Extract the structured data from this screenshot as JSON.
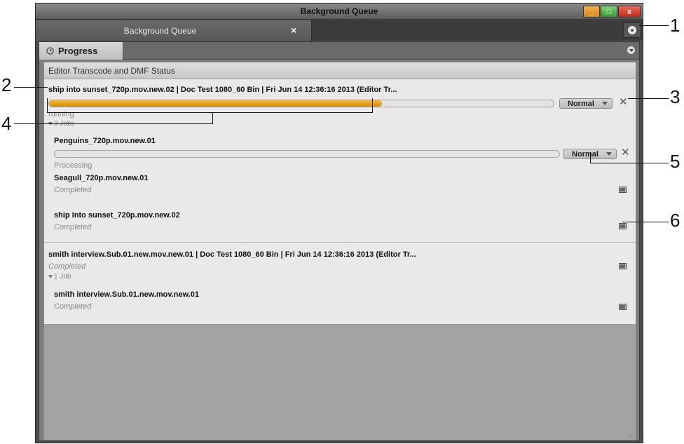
{
  "window": {
    "title": "Background Queue",
    "controls": {
      "minimize": "_",
      "maximize": "□",
      "close": "x"
    }
  },
  "tabs": {
    "main_label": "Background Queue",
    "close_glyph": "×"
  },
  "panel": {
    "progress_tab": "Progress",
    "header": "Editor Transcode and DMF Status"
  },
  "groups": [
    {
      "title": "ship into sunset_720p.mov.new.02 | Doc Test 1080_60 Bin | Fri Jun 14 12:36:16 2013 (Editor Tr...",
      "progress": 0.66,
      "priority": "Normal",
      "status": "running",
      "jobs_label": "3 Jobs",
      "jobs": [
        {
          "title": "Penguins_720p.mov.new.01",
          "status": "Processing",
          "progress": 0.0,
          "priority": "Normal"
        },
        {
          "title": "Seagull_720p.mov.new.01",
          "status": "Completed"
        },
        {
          "title": "ship into sunset_720p.mov.new.02",
          "status": "Completed"
        }
      ]
    },
    {
      "title": "smith interview.Sub.01.new.mov.new.01 | Doc Test 1080_60 Bin | Fri Jun 14 12:36:16 2013 (Editor Tr...",
      "status": "Completed",
      "jobs_label": "1 Job",
      "jobs": [
        {
          "title": "smith interview.Sub.01.new.mov.new.01",
          "status": "Completed"
        }
      ]
    }
  ],
  "callouts": [
    "1",
    "2",
    "3",
    "4",
    "5",
    "6"
  ],
  "colors": {
    "progress_fill": "#e6a000",
    "window_bg": "#4d4d4d",
    "list_bg": "#e9e9e9"
  }
}
